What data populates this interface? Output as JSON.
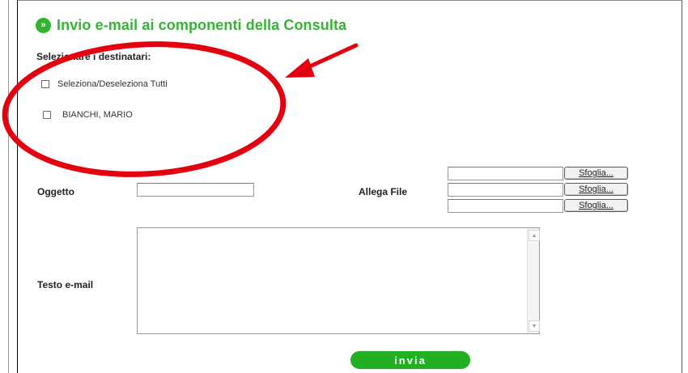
{
  "header": {
    "title": "Invio e-mail ai componenti della Consulta",
    "icon": "double-chevron-right-icon",
    "icon_glyph": "»",
    "title_color": "#33b533"
  },
  "recipients": {
    "label": "Selezionare i destinatari:",
    "select_all_label": "Seleziona/Deseleziona Tutti",
    "select_all_checked": false,
    "items": [
      {
        "name": "BIANCHI, MARIO",
        "checked": false
      }
    ]
  },
  "form": {
    "subject_label": "Oggetto",
    "subject_value": "",
    "attach_label": "Allega File",
    "attachments": [
      {
        "value": "",
        "button_label": "Sfoglia..."
      },
      {
        "value": "",
        "button_label": "Sfoglia..."
      },
      {
        "value": "",
        "button_label": "Sfoglia..."
      }
    ],
    "body_label": "Testo e-mail",
    "body_value": ""
  },
  "actions": {
    "send_label": "invia",
    "send_color": "#22b022"
  },
  "annotation": {
    "highlight_color": "#e3000f"
  }
}
